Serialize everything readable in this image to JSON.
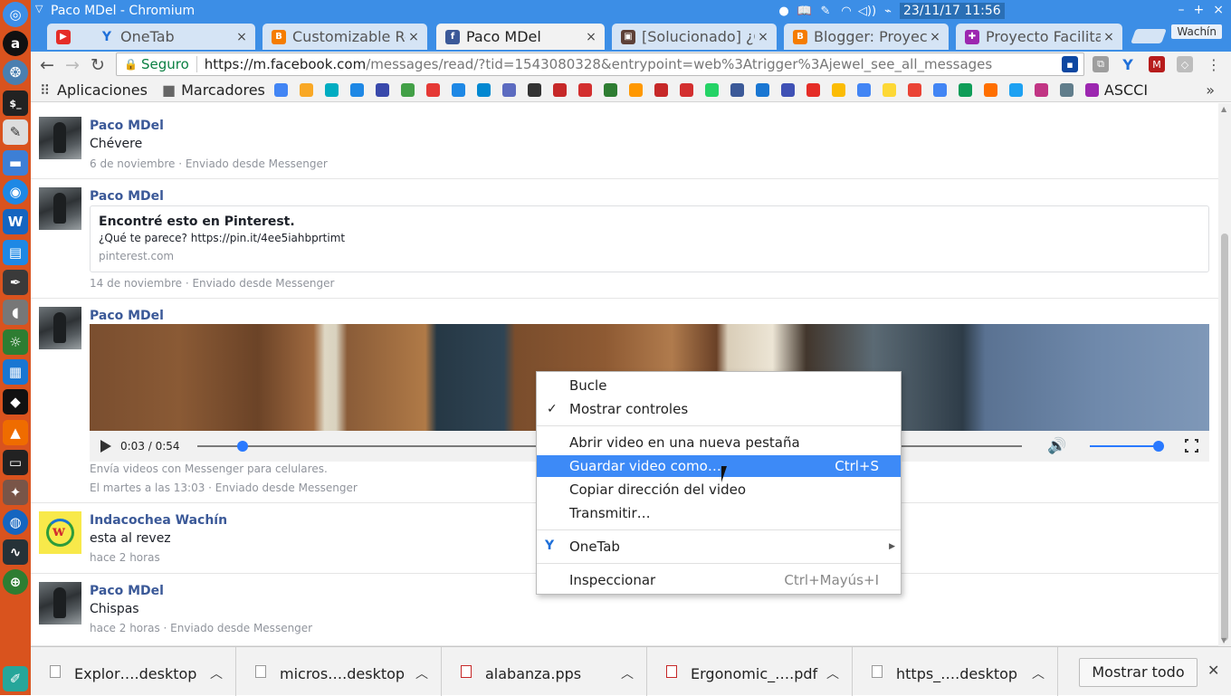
{
  "window": {
    "title": "Paco MDel - Chromium",
    "clock": "23/11/17 11:56",
    "controls": [
      "–",
      "+",
      "×"
    ]
  },
  "tabs": [
    {
      "label": "",
      "favicon": "youtube-icon",
      "color": "#e52d27",
      "close": "×"
    },
    {
      "label": "OneTab",
      "favicon": "onetab-icon",
      "color": "#1e6fd9",
      "close": "×"
    },
    {
      "label": "Customizable Rela",
      "favicon": "blogger-icon",
      "color": "#f57c00",
      "close": "×"
    },
    {
      "label": "Paco MDel",
      "favicon": "facebook-icon",
      "color": "#3b5998",
      "close": "×",
      "active": true
    },
    {
      "label": "[Solucionado] ¿Cóm",
      "favicon": "forum-icon",
      "color": "#5d4037",
      "close": "×"
    },
    {
      "label": "Blogger: Proyecto",
      "favicon": "blogger-icon",
      "color": "#f57c00",
      "close": "×"
    },
    {
      "label": "Proyecto Facilitar a",
      "favicon": "project-icon",
      "color": "#9c27b0",
      "close": "×"
    }
  ],
  "profile_button": "Wachín",
  "omnibox": {
    "secure_label": "Seguro",
    "url_host": "https://m.facebook.com",
    "url_rest": "/messages/read/?tid=1543080328&entrypoint=web%3Atrigger%3Ajewel_see_all_messages"
  },
  "bookmarks": {
    "apps_label": "Aplicaciones",
    "folder_label": "Marcadores",
    "last_label": "ASCCI",
    "more": "»"
  },
  "messages": [
    {
      "sender": "Paco MDel",
      "text": "Chévere",
      "meta": "6 de noviembre · Enviado desde Messenger"
    },
    {
      "sender": "Paco MDel",
      "card_title": "Encontré esto en Pinterest.",
      "card_desc": "¿Qué te parece? https://pin.it/4ee5iahbprtimt",
      "card_domain": "pinterest.com",
      "meta": "14 de noviembre · Enviado desde Messenger"
    },
    {
      "sender": "Paco MDel",
      "video_time": "0:03 / 0:54",
      "video_progress": 0.055,
      "volume": 1.0,
      "note": "Envía videos con Messenger para celulares.",
      "meta": "El martes a las 13:03 · Enviado desde Messenger"
    },
    {
      "sender": "Indacochea Wachín",
      "text": "esta al revez",
      "meta": "hace 2 horas"
    },
    {
      "sender": "Paco MDel",
      "text": "Chispas",
      "meta": "hace 2 horas · Enviado desde Messenger"
    }
  ],
  "context_menu": {
    "items": [
      {
        "label": "Bucle"
      },
      {
        "label": "Mostrar controles",
        "checked": true
      },
      {
        "label": "Abrir video en una nueva pestaña"
      },
      {
        "label": "Guardar video como…",
        "shortcut": "Ctrl+S",
        "highlighted": true
      },
      {
        "label": "Copiar dirección del video"
      },
      {
        "label": "Transmitir…"
      },
      {
        "label": "OneTab",
        "submenu": true
      },
      {
        "label": "Inspeccionar",
        "shortcut": "Ctrl+Mayús+I"
      }
    ]
  },
  "downloads": [
    {
      "name": "Explor….desktop"
    },
    {
      "name": "micros….desktop"
    },
    {
      "name": "alabanza.pps"
    },
    {
      "name": "Ergonomic_….pdf"
    },
    {
      "name": "https_….desktop"
    }
  ],
  "show_all_label": "Mostrar todo",
  "colors": {
    "accent": "#3c8ee6",
    "facebook_name": "#3b5998",
    "menu_highlight": "#3d8af7",
    "launcher": "#d9531e"
  }
}
